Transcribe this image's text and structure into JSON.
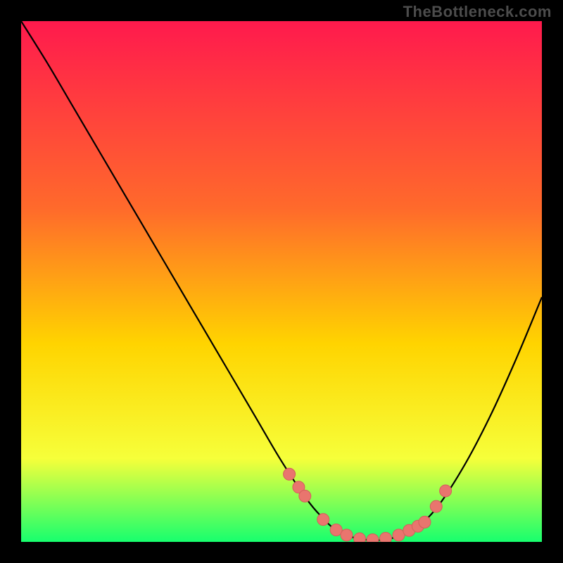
{
  "watermark": "TheBottleneck.com",
  "colors": {
    "grad_top": "#ff1a4d",
    "grad_mid1": "#ff6a2b",
    "grad_mid2": "#ffd400",
    "grad_mid3": "#f6ff3a",
    "grad_bot": "#17ff6e",
    "curve": "#000000",
    "marker_fill": "#e9756e",
    "marker_stroke": "#d45f5a",
    "background": "#000000"
  },
  "chart_data": {
    "type": "line",
    "title": "",
    "xlabel": "",
    "ylabel": "",
    "xlim": [
      0,
      100
    ],
    "ylim": [
      0,
      100
    ],
    "grid": false,
    "legend_position": "none",
    "series": [
      {
        "name": "bottleneck-curve",
        "x": [
          0,
          5,
          10,
          15,
          20,
          25,
          30,
          35,
          40,
          45,
          50,
          55,
          58,
          60,
          62,
          65,
          68,
          70,
          73,
          76,
          80,
          85,
          90,
          95,
          100
        ],
        "values": [
          100,
          92,
          83.5,
          75,
          66.5,
          58,
          49.5,
          41,
          32.5,
          24,
          15.5,
          8,
          4.5,
          2.6,
          1.4,
          0.6,
          0.3,
          0.5,
          1.2,
          2.8,
          6.8,
          14.5,
          24,
          35,
          47
        ]
      }
    ],
    "markers": {
      "name": "highlight-dots",
      "x": [
        51.5,
        53.3,
        54.5,
        58.0,
        60.5,
        62.5,
        65.0,
        67.5,
        70.0,
        72.5,
        74.5,
        76.2,
        77.5,
        79.7,
        81.5
      ],
      "values": [
        13.0,
        10.5,
        8.8,
        4.3,
        2.3,
        1.3,
        0.6,
        0.4,
        0.7,
        1.3,
        2.2,
        3.0,
        3.8,
        6.8,
        9.8
      ]
    }
  }
}
